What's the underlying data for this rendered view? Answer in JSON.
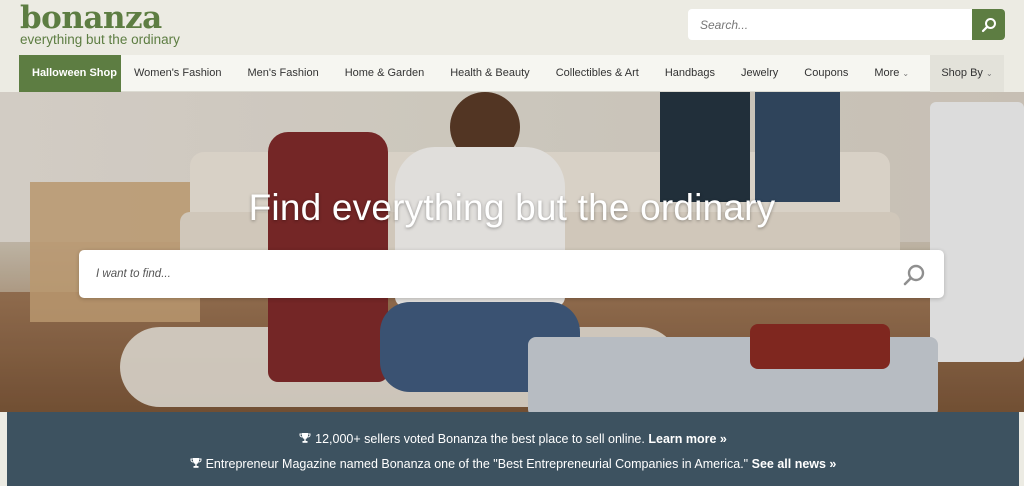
{
  "header": {
    "logo_word": "bonanza",
    "logo_tagline": "everything but the ordinary",
    "search_placeholder": "Search...",
    "search_button_icon": "search-icon"
  },
  "nav": {
    "items": [
      {
        "label": "Halloween Shop"
      },
      {
        "label": "Women's Fashion"
      },
      {
        "label": "Men's Fashion"
      },
      {
        "label": "Home & Garden"
      },
      {
        "label": "Health & Beauty"
      },
      {
        "label": "Collectibles & Art"
      },
      {
        "label": "Handbags"
      },
      {
        "label": "Jewelry"
      },
      {
        "label": "Coupons"
      },
      {
        "label": "More"
      }
    ],
    "shop_by": "Shop By"
  },
  "hero": {
    "title": "Find everything but the ordinary",
    "search_placeholder": "I want to find..."
  },
  "banner": {
    "line1_text": "12,000+ sellers voted Bonanza the best place to sell online.",
    "line1_link": "Learn more »",
    "line2_text": "Entrepreneur Magazine named Bonanza one of the \"Best Entrepreneurial Companies in America.\"",
    "line2_link": "See all news »"
  },
  "colors": {
    "brand_green": "#5d7d42",
    "banner_bg": "#3d5260",
    "header_bg": "#ecebe3"
  }
}
